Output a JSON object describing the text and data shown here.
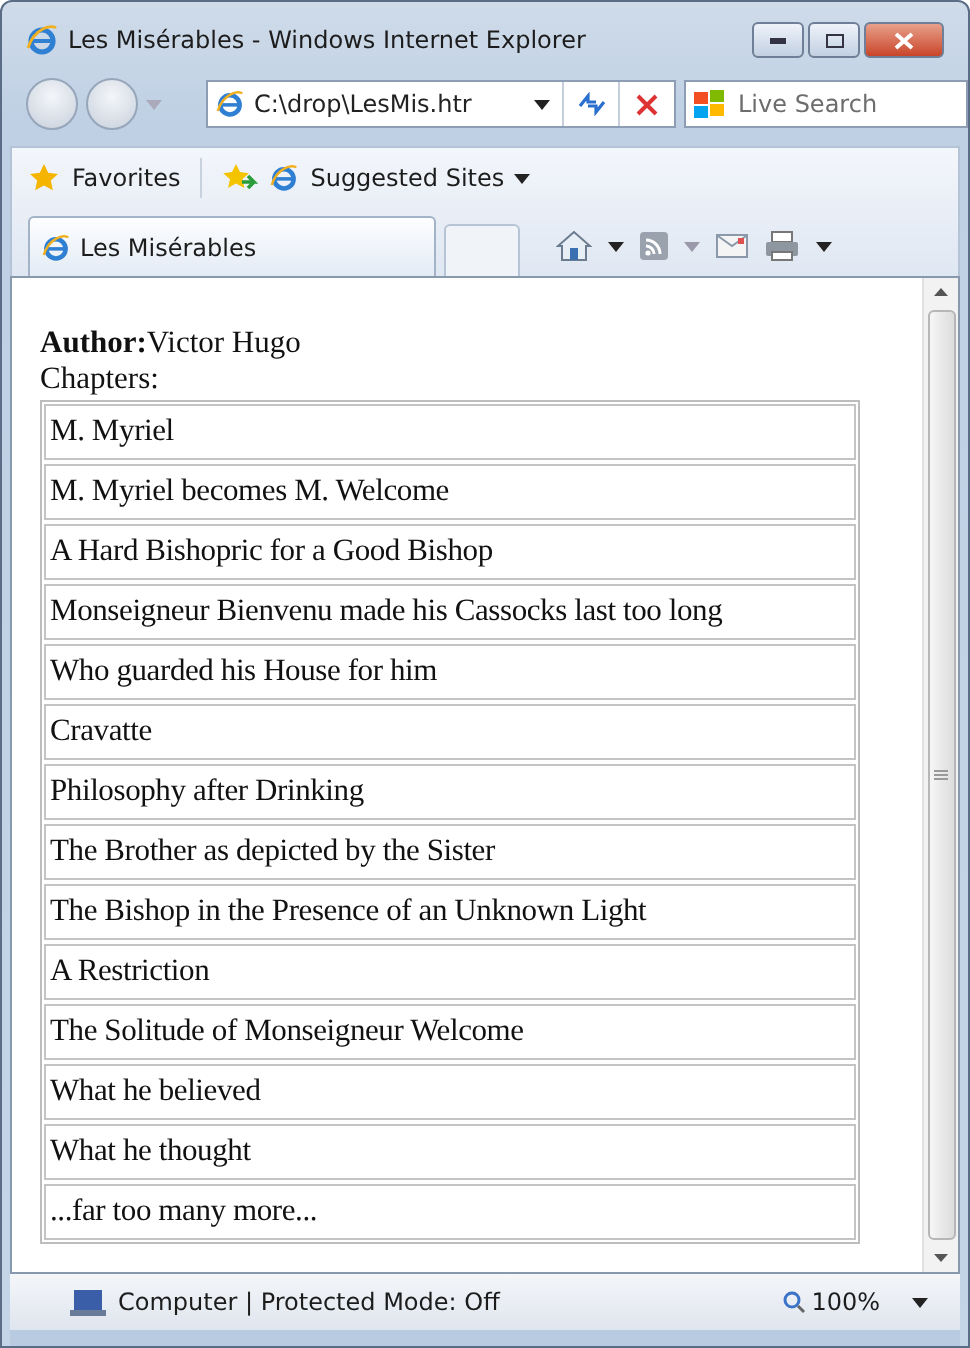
{
  "window": {
    "title": "Les Misérables - Windows Internet Explorer"
  },
  "address_bar": {
    "value": "C:\\drop\\LesMis.htr"
  },
  "search": {
    "placeholder": "Live Search"
  },
  "favorites_bar": {
    "favorites": "Favorites",
    "suggested_sites": "Suggested Sites"
  },
  "tab": {
    "title": "Les Misérables"
  },
  "page": {
    "author_label": "Author:",
    "author": "Victor Hugo",
    "chapters_label": "Chapters:",
    "chapters": [
      "M. Myriel",
      "M. Myriel becomes M. Welcome",
      "A Hard Bishopric for a Good Bishop",
      "Monseigneur Bienvenu made his Cassocks last too long",
      "Who guarded his House for him",
      "Cravatte",
      "Philosophy after Drinking",
      "The Brother as depicted by the Sister",
      "The Bishop in the Presence of an Unknown Light",
      "A Restriction",
      "The Solitude of Monseigneur Welcome",
      "What he believed",
      "What he thought",
      "...far too many more..."
    ]
  },
  "status_bar": {
    "zone": "Computer | Protected Mode: Off",
    "zoom": "100%"
  }
}
